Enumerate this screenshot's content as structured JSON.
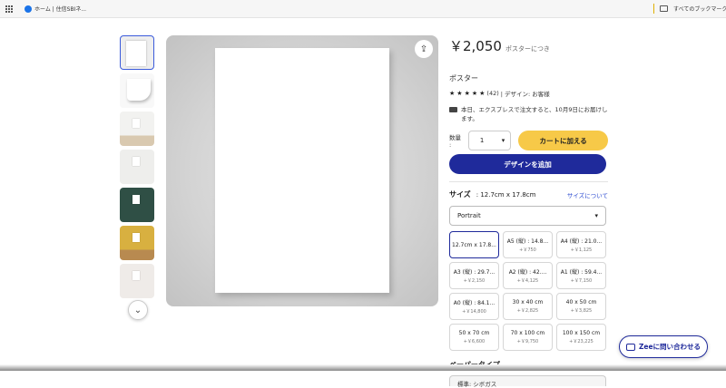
{
  "bookmarks": {
    "first": "ホーム | 住信SBIネ...",
    "all": "すべてのブックマーク"
  },
  "product": {
    "price": "￥2,050",
    "per": "ポスターにつき",
    "type": "ポスター",
    "rating_count": "(42)",
    "design_by": "| デザイン: お客様",
    "shipping": "本日、エクスプレスで注文すると、10月9日にお届けします。",
    "qty_label": "数量 :",
    "qty_value": "1",
    "cart_label": "カートに加える",
    "design_label": "デザインを追加"
  },
  "size": {
    "title": "サイズ",
    "current": ": 12.7cm x 17.8cm",
    "about_link": "サイズについて",
    "orientation": "Portrait",
    "options": [
      {
        "name": "12.7cm x 17.8...",
        "price": ""
      },
      {
        "name": "A5 (縦) : 14.8...",
        "price": "+￥750"
      },
      {
        "name": "A4 (縦) : 21.0...",
        "price": "+￥1,125"
      },
      {
        "name": "A3 (縦) : 29.7...",
        "price": "+￥2,150"
      },
      {
        "name": "A2 (縦) : 42....",
        "price": "+￥4,125"
      },
      {
        "name": "A1 (縦) : 59.4...",
        "price": "+￥7,150"
      },
      {
        "name": "A0 (縦) : 84.1...",
        "price": "+￥14,800"
      },
      {
        "name": "30 x 40 cm",
        "price": "+￥2,825"
      },
      {
        "name": "40 x 50 cm",
        "price": "+￥3,825"
      },
      {
        "name": "50 x 70 cm",
        "price": "+￥6,600"
      },
      {
        "name": "70 x 100 cm",
        "price": "+￥9,750"
      },
      {
        "name": "100 x 150 cm",
        "price": "+￥23,225"
      }
    ]
  },
  "paper": {
    "title": "ペーパータイプ",
    "value": "標準: シボガス"
  },
  "chat": {
    "label": "Zeeに問い合わせる"
  }
}
